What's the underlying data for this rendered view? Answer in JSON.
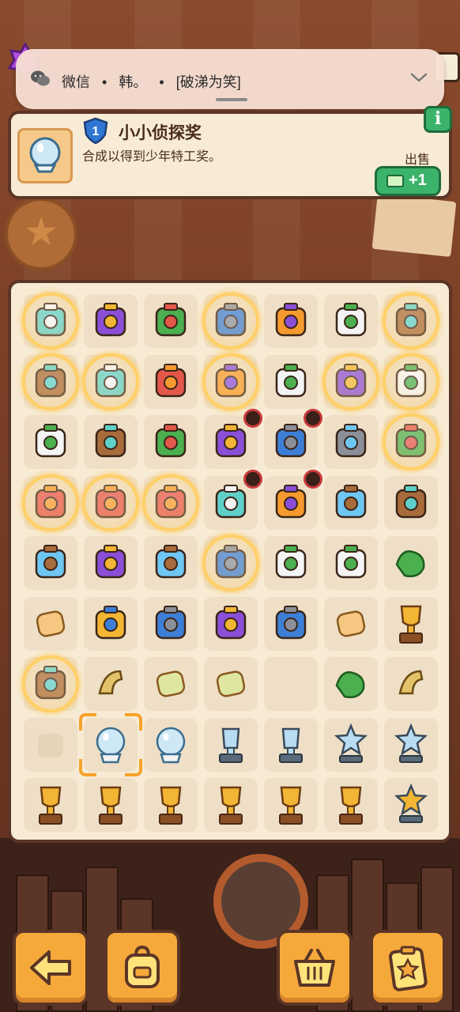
{
  "notification": {
    "app": "微信",
    "sender": "韩。",
    "message": "[破涕为笑]",
    "separator": "•"
  },
  "info_panel": {
    "level": "1",
    "title": "小小侦探奖",
    "description": "合成以得到少年特工奖。",
    "sell_label": "出售",
    "sell_value": "+1",
    "info_icon": "i"
  },
  "board": {
    "columns": 7,
    "rows": 9,
    "items": [
      [
        "pie-bubble",
        "water-bottle-item",
        "snake-toy-item",
        "tea-bubble",
        "water-jug-item",
        "sheep-toy-item",
        "box-bubble"
      ],
      [
        "donut-bubble",
        "robot-bubble",
        "smoothie-item",
        "plant-bubble",
        "juice-can-item",
        "burger-bubble",
        "map-bubble"
      ],
      [
        "orange-juice-item",
        "bento-box-item",
        "paper-box-item",
        "locked-cash-register",
        "locked-portrait",
        "dragon-book-item",
        "treasure-bubble"
      ],
      [
        "toybox-bubble",
        "backpack-bubble",
        "backpack-bubble",
        "locked-detective-card",
        "locked-easel",
        "thermometer-item",
        "microscope-item"
      ],
      [
        "folding-bike-item",
        "magnifier-item",
        "camera-item",
        "radio-bubble",
        "first-aid-kit-item",
        "flower-pot-item",
        "green-bottle-item"
      ],
      [
        "cookie-item",
        "travel-backpack-item",
        "envelope-item",
        "cone-item",
        "binoculars-item",
        "cookie-pair-item",
        "gold-ring-item"
      ],
      [
        "toy-car-bubble",
        "croissant-item",
        "soap-item",
        "sponge-item",
        "empty",
        "green-cloth-item",
        "boot-item"
      ],
      [
        "empty-faded",
        "crystal-ball-selected",
        "crystal-ball-item",
        "glass-trophy-item",
        "glass-award-item",
        "crystal-star-item",
        "crystal-star-tilt-item"
      ],
      [
        "gold-cup-item",
        "gold-star-statue",
        "gold-bird-item",
        "gold-winged-item",
        "gold-chess-item",
        "gold-pillar-item",
        "gold-star-trophy"
      ]
    ]
  },
  "buttons": [
    {
      "name": "back-button",
      "icon": "arrow-left-icon"
    },
    {
      "name": "backpack-button",
      "icon": "backpack-icon"
    },
    {
      "name": "shop-basket-button",
      "icon": "basket-icon"
    },
    {
      "name": "task-board-button",
      "icon": "clipboard-star-icon"
    }
  ],
  "colors": {
    "accent": "#f6a93b",
    "board_bg": "#f7ebd5",
    "border": "#5b3526",
    "sell_green": "#3bb36b",
    "bubble_gold": "#ffd067"
  }
}
